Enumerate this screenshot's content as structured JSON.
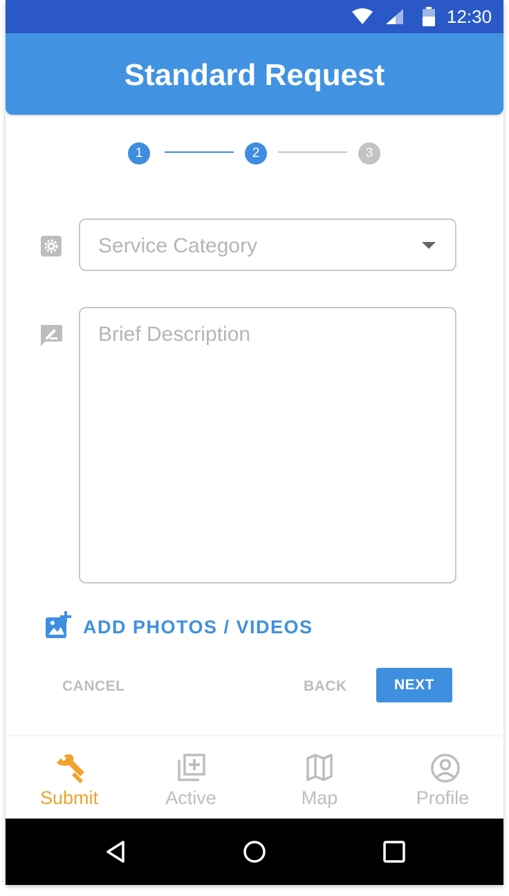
{
  "status_bar": {
    "time": "12:30",
    "background": "#2a59c7",
    "icons": [
      "wifi-icon",
      "cellular-signal-icon",
      "battery-icon"
    ]
  },
  "app_bar": {
    "title": "Standard Request",
    "background": "#4193e2"
  },
  "stepper": {
    "steps": [
      {
        "label": "1",
        "state": "completed"
      },
      {
        "label": "2",
        "state": "current"
      },
      {
        "label": "3",
        "state": "upcoming"
      }
    ],
    "active_color": "#3e8de0",
    "inactive_color": "#c3c3c3"
  },
  "form": {
    "service_category": {
      "placeholder": "Service Category",
      "value": "",
      "icon": "gear-icon"
    },
    "description": {
      "placeholder": "Brief Description",
      "value": "",
      "icon": "rate-review-icon"
    },
    "add_media": {
      "label": "ADD PHOTOS / VIDEOS",
      "icon": "add-photo-icon"
    }
  },
  "actions": {
    "cancel_label": "CANCEL",
    "back_label": "BACK",
    "next_label": "NEXT",
    "primary_color": "#3f8fe0"
  },
  "bottom_nav": {
    "items": [
      {
        "label": "Submit",
        "icon": "wrench-icon",
        "active": true
      },
      {
        "label": "Active",
        "icon": "library-add-icon",
        "active": false
      },
      {
        "label": "Map",
        "icon": "map-icon",
        "active": false
      },
      {
        "label": "Profile",
        "icon": "account-circle-icon",
        "active": false
      }
    ],
    "active_color": "#f0a22e",
    "inactive_color": "#bdbdbd"
  },
  "system_nav": {
    "icons": [
      "back-triangle-icon",
      "home-circle-icon",
      "recents-square-icon"
    ]
  }
}
